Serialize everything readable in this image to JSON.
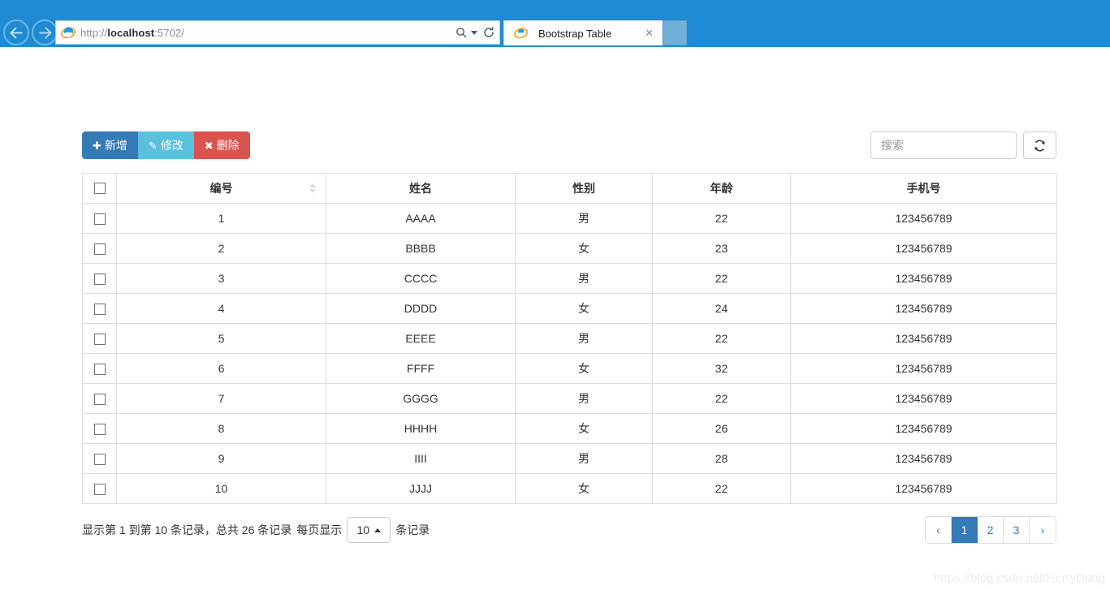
{
  "browser": {
    "back_label": "←",
    "forward_label": "→",
    "url_prefix": "http://",
    "url_host": "localhost",
    "url_suffix": ":5702/",
    "search_icon": "search-icon",
    "refresh_icon": "refresh-icon",
    "tab_title": "Bootstrap Table",
    "tab_close_label": "✕",
    "newtab_label": ""
  },
  "toolbar": {
    "buttons": [
      {
        "label": "新增",
        "glyph": "✚",
        "style": "primary",
        "name": "add-button"
      },
      {
        "label": "修改",
        "glyph": "✎",
        "style": "info",
        "name": "edit-button"
      },
      {
        "label": "删除",
        "glyph": "✖",
        "style": "danger",
        "name": "delete-button"
      }
    ],
    "search_placeholder": "搜索",
    "search_value": "",
    "refresh_title": "refresh"
  },
  "table": {
    "columns": [
      {
        "key": "check",
        "label": ""
      },
      {
        "key": "id",
        "label": "编号",
        "sortable": true
      },
      {
        "key": "name",
        "label": "姓名"
      },
      {
        "key": "sex",
        "label": "性别"
      },
      {
        "key": "age",
        "label": "年龄"
      },
      {
        "key": "phone",
        "label": "手机号"
      }
    ],
    "rows": [
      {
        "id": "1",
        "name": "AAAA",
        "sex": "男",
        "age": "22",
        "phone": "123456789"
      },
      {
        "id": "2",
        "name": "BBBB",
        "sex": "女",
        "age": "23",
        "phone": "123456789"
      },
      {
        "id": "3",
        "name": "CCCC",
        "sex": "男",
        "age": "22",
        "phone": "123456789"
      },
      {
        "id": "4",
        "name": "DDDD",
        "sex": "女",
        "age": "24",
        "phone": "123456789"
      },
      {
        "id": "5",
        "name": "EEEE",
        "sex": "男",
        "age": "22",
        "phone": "123456789"
      },
      {
        "id": "6",
        "name": "FFFF",
        "sex": "女",
        "age": "32",
        "phone": "123456789"
      },
      {
        "id": "7",
        "name": "GGGG",
        "sex": "男",
        "age": "22",
        "phone": "123456789"
      },
      {
        "id": "8",
        "name": "HHHH",
        "sex": "女",
        "age": "26",
        "phone": "123456789"
      },
      {
        "id": "9",
        "name": "IIII",
        "sex": "男",
        "age": "28",
        "phone": "123456789"
      },
      {
        "id": "10",
        "name": "JJJJ",
        "sex": "女",
        "age": "22",
        "phone": "123456789"
      }
    ]
  },
  "footer": {
    "info_before": "显示第 1 到第 10 条记录，总共 26 条记录",
    "per_page_label": "每页显示",
    "per_page_value": "10",
    "info_after": "条记录",
    "pages": [
      {
        "label": "‹",
        "name": "pagination-prev",
        "active": false
      },
      {
        "label": "1",
        "name": "pagination-page-1",
        "active": true
      },
      {
        "label": "2",
        "name": "pagination-page-2",
        "active": false
      },
      {
        "label": "3",
        "name": "pagination-page-3",
        "active": false
      },
      {
        "label": "›",
        "name": "pagination-next",
        "active": false
      }
    ]
  },
  "watermark": "https://blog.csdn.net/HerryDong",
  "colors": {
    "primary": "#337ab7",
    "info": "#5bc0de",
    "danger": "#d9534f",
    "chrome_blue": "#1e8bd4",
    "border": "#dddddd"
  }
}
